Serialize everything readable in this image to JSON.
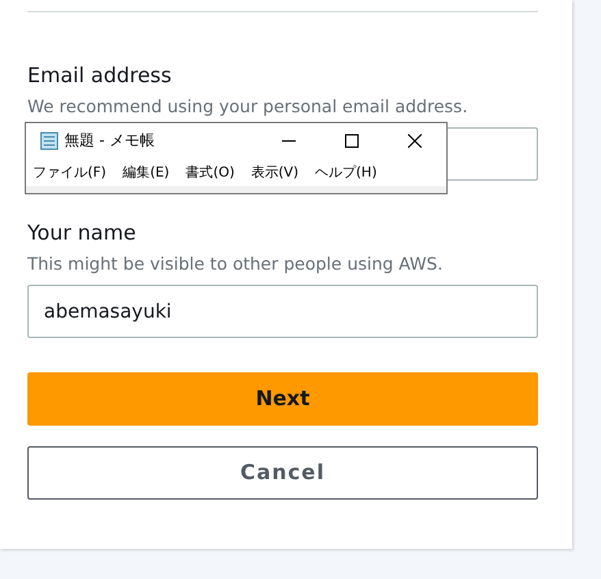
{
  "form": {
    "fields": [
      {
        "label": "Email address",
        "hint": "We recommend using your personal email address."
      },
      {
        "label": "Your name",
        "hint": "This might be visible to other people using AWS.",
        "value": "abemasayuki"
      }
    ],
    "buttons": [
      {
        "label": "Next",
        "kind": "primary"
      },
      {
        "label": "Cancel",
        "kind": "secondary"
      }
    ]
  },
  "notepad_window": {
    "title": "無題 - メモ帳",
    "menu": [
      "ファイル(F)",
      "編集(E)",
      "書式(O)",
      "表示(V)",
      "ヘルプ(H)"
    ]
  }
}
